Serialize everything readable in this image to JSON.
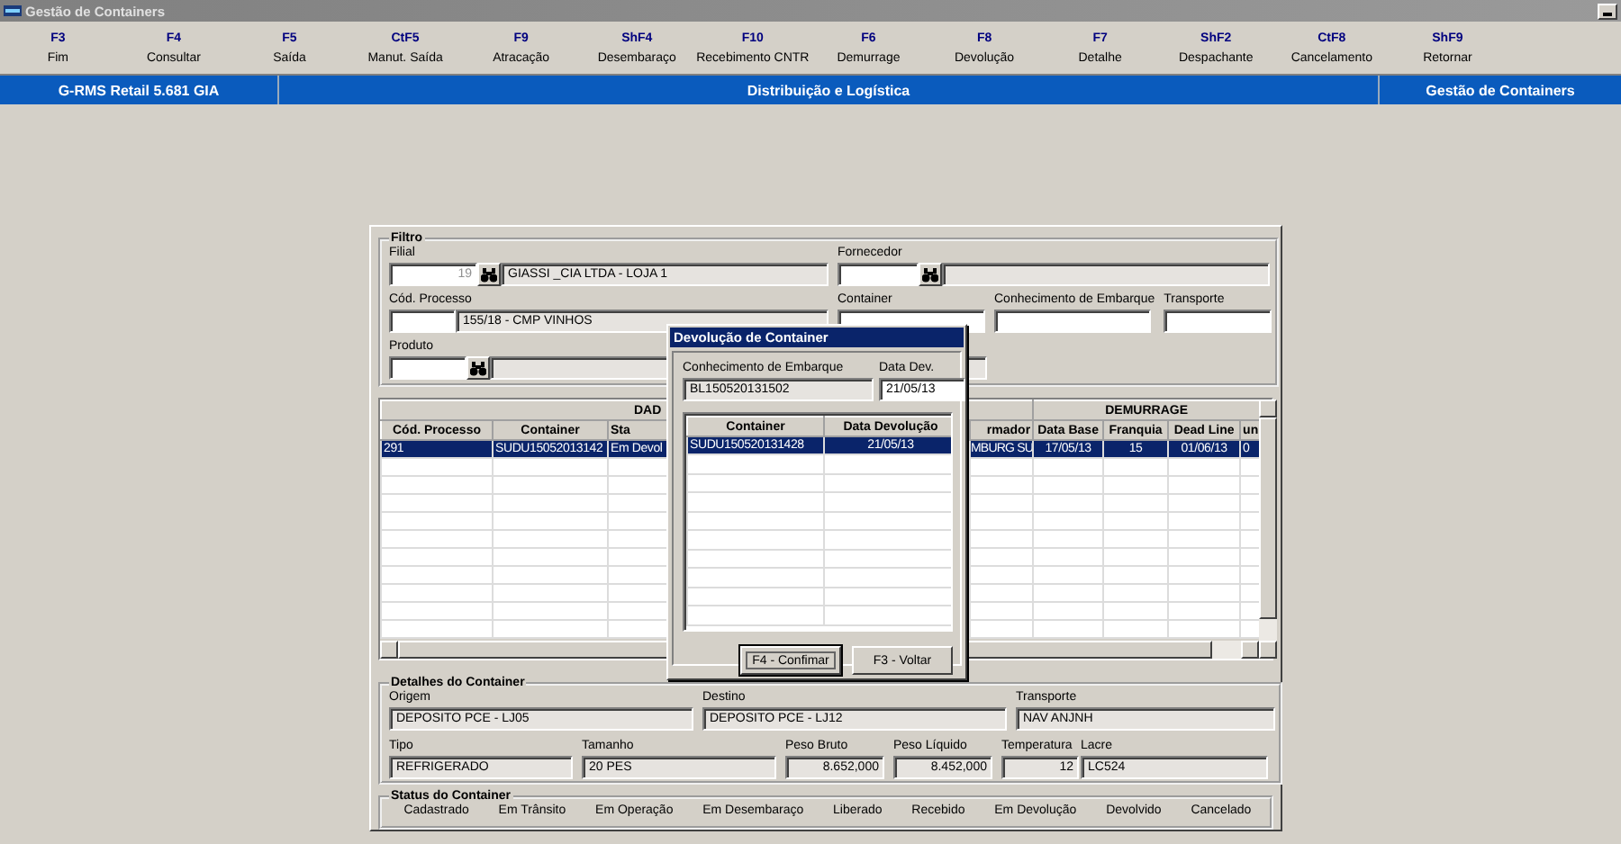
{
  "window": {
    "title": "Gestão de Containers"
  },
  "toolbar": [
    {
      "key": "F3",
      "label": "Fim"
    },
    {
      "key": "F4",
      "label": "Consultar"
    },
    {
      "key": "F5",
      "label": "Saída"
    },
    {
      "key": "CtF5",
      "label": "Manut. Saída"
    },
    {
      "key": "F9",
      "label": "Atracação"
    },
    {
      "key": "ShF4",
      "label": "Desembaraço"
    },
    {
      "key": "F10",
      "label": "Recebimento CNTR"
    },
    {
      "key": "F6",
      "label": "Demurrage"
    },
    {
      "key": "F8",
      "label": "Devolução"
    },
    {
      "key": "F7",
      "label": "Detalhe"
    },
    {
      "key": "ShF2",
      "label": "Despachante"
    },
    {
      "key": "CtF8",
      "label": "Cancelamento"
    },
    {
      "key": "ShF9",
      "label": "Retornar"
    }
  ],
  "banner": [
    "G-RMS Retail 5.681 GIA",
    "Distribuição e Logística",
    "Gestão de Containers"
  ],
  "filter": {
    "title": "Filtro",
    "filial": {
      "label": "Filial",
      "code": "19",
      "disabled": true,
      "name": "GIASSI _CIA LTDA - LOJA 1"
    },
    "fornecedor": {
      "label": "Fornecedor"
    },
    "processo": {
      "label": "Cód. Processo",
      "name": "155/18 - CMP VINHOS"
    },
    "container": {
      "label": "Container"
    },
    "conhecimento": {
      "label": "Conhecimento de Embarque"
    },
    "transporte": {
      "label": "Transporte"
    },
    "produto": {
      "label": "Produto"
    }
  },
  "table": {
    "groups": [
      "DAD",
      "DEMURRAGE"
    ],
    "columns": [
      "Cód. Processo",
      "Container",
      "Sta",
      "rmador",
      "Data Base",
      "Franquia",
      "Dead Line",
      "un"
    ],
    "rows": [
      {
        "cells": [
          "291",
          "SUDU15052013142",
          "Em Devol",
          "MBURG SU",
          "17/05/13",
          "15",
          "01/06/13",
          "0"
        ],
        "selected": true
      }
    ]
  },
  "details": {
    "title": "Detalhes do Container",
    "fields": [
      {
        "label": "Origem",
        "value": "DEPOSITO PCE - LJ05"
      },
      {
        "label": "Destino",
        "value": "DEPOSITO PCE - LJ12"
      },
      {
        "label": "Transporte",
        "value": "NAV ANJNH"
      },
      {
        "label": "Tipo",
        "value": "REFRIGERADO"
      },
      {
        "label": "Tamanho",
        "value": "20 PES"
      },
      {
        "label": "Peso Bruto",
        "value": "8.652,000"
      },
      {
        "label": "Peso Líquido",
        "value": "8.452,000"
      },
      {
        "label": "Temperatura",
        "value": "12"
      },
      {
        "label": "Lacre",
        "value": "LC524"
      }
    ]
  },
  "status": {
    "title": "Status do Container",
    "items": [
      "Cadastrado",
      "Em Trânsito",
      "Em Operação",
      "Em Desembaraço",
      "Liberado",
      "Recebido",
      "Em Devolução",
      "Devolvido",
      "Cancelado"
    ]
  },
  "dialog": {
    "title": "Devolução de Container",
    "conhecimento": {
      "label": "Conhecimento de Embarque",
      "value": "BL150520131502"
    },
    "data": {
      "label": "Data Dev.",
      "value": "21/05/13"
    },
    "columns": [
      "Container",
      "Data Devolução"
    ],
    "rows": [
      {
        "cells": [
          "SUDU150520131428",
          "21/05/13"
        ],
        "selected": true
      }
    ],
    "buttons": [
      {
        "label": "F4 - Confimar",
        "focused": true
      },
      {
        "label": "F3 - Voltar",
        "focused": false
      }
    ]
  }
}
